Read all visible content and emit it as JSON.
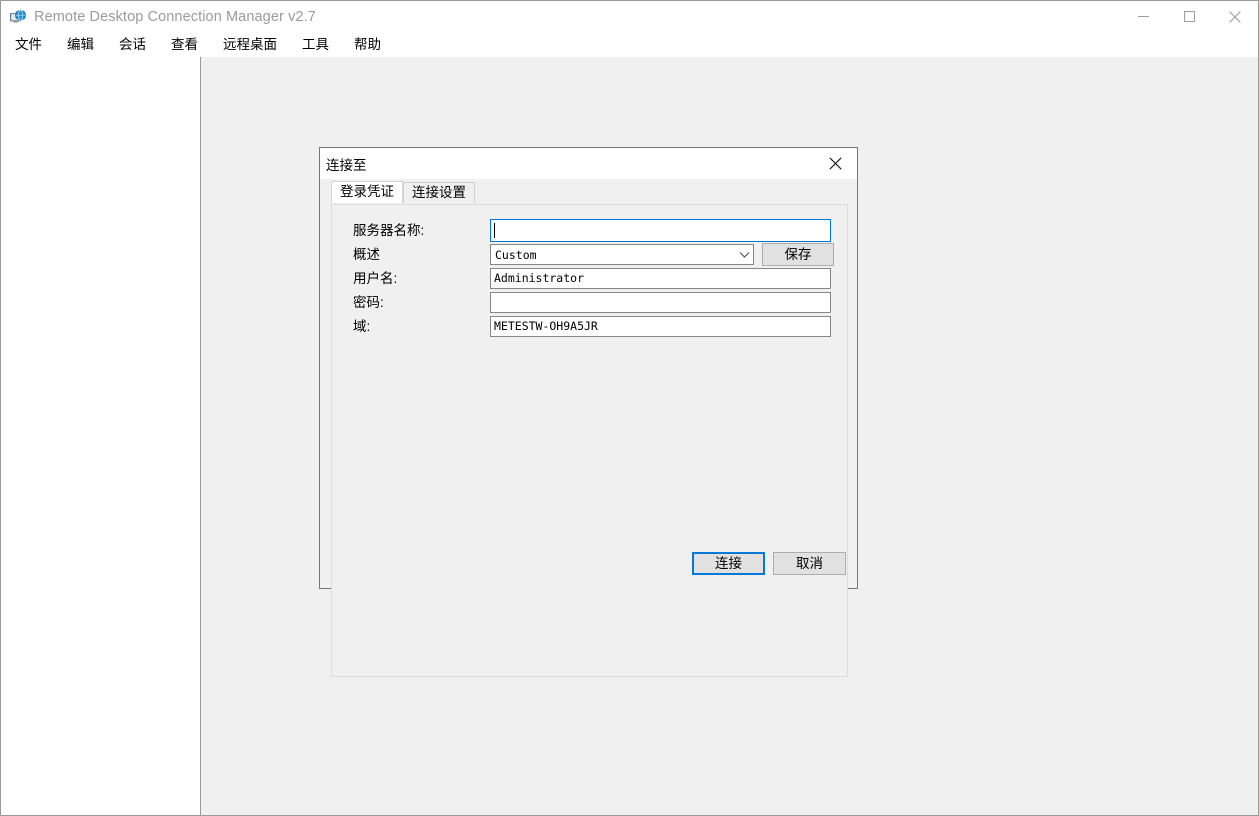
{
  "window": {
    "title": "Remote Desktop Connection Manager v2.7",
    "icon": "remote-desktop-app-icon",
    "controls": {
      "minimize": "minimize-icon",
      "maximize": "maximize-icon",
      "close": "close-icon"
    }
  },
  "menubar": {
    "items": [
      {
        "label": "文件"
      },
      {
        "label": "编辑"
      },
      {
        "label": "会话"
      },
      {
        "label": "查看"
      },
      {
        "label": "远程桌面"
      },
      {
        "label": "工具"
      },
      {
        "label": "帮助"
      }
    ]
  },
  "dialog": {
    "title": "连接至",
    "close_icon": "close-icon",
    "tabs": [
      {
        "label": "登录凭证",
        "active": true
      },
      {
        "label": "连接设置",
        "active": false
      }
    ],
    "fields": [
      {
        "label": "服务器名称:",
        "value": "",
        "type": "text",
        "focused": true
      },
      {
        "label": "概述",
        "value": "Custom",
        "type": "combobox",
        "focused": false
      },
      {
        "label": "用户名:",
        "value": "Administrator",
        "type": "text",
        "focused": false
      },
      {
        "label": "密码:",
        "value": "",
        "type": "password",
        "focused": false
      },
      {
        "label": "域:",
        "value": "METESTW-OH9A5JR",
        "type": "text",
        "focused": false
      }
    ],
    "save_label": "保存",
    "connect_label": "连接",
    "cancel_label": "取消"
  },
  "colors": {
    "accent": "#0078d7",
    "window_bg": "#f0f0f0",
    "panel_bg": "#ffffff",
    "button_bg": "#e1e1e1",
    "title_text": "#9b9b9b"
  }
}
